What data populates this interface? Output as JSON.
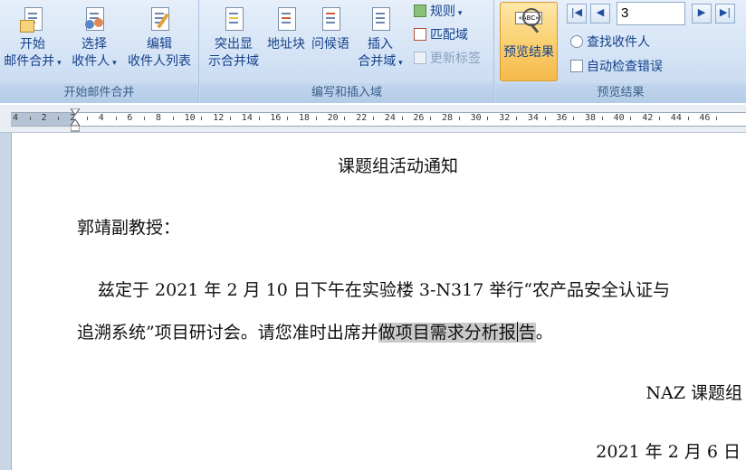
{
  "ribbon": {
    "groups": [
      {
        "label": "开始邮件合并"
      },
      {
        "label": "编写和插入域"
      },
      {
        "label": "预览结果"
      }
    ],
    "start_merge": {
      "line1": "开始",
      "line2": "邮件合并"
    },
    "select_recipients": {
      "line1": "选择",
      "line2": "收件人"
    },
    "edit_recipients": {
      "line1": "编辑",
      "line2": "收件人列表"
    },
    "highlight_fields": {
      "line1": "突出显",
      "line2": "示合并域"
    },
    "address_block": {
      "label": "地址块"
    },
    "greeting_line": {
      "label": "问候语"
    },
    "insert_field": {
      "line1": "插入",
      "line2": "合并域"
    },
    "rules": {
      "label": "规则"
    },
    "match_fields": {
      "label": "匹配域"
    },
    "update_labels": {
      "label": "更新标签"
    },
    "preview_results": {
      "label": "预览结果"
    },
    "record_value": "3",
    "find_recipient": {
      "label": "查找收件人"
    },
    "auto_check": {
      "label": "自动检查错误"
    }
  },
  "ruler": {
    "labels": [
      "4",
      "2",
      "2",
      "4",
      "6",
      "8",
      "10",
      "12",
      "14",
      "16",
      "18",
      "20",
      "22",
      "24",
      "26",
      "28",
      "30",
      "32",
      "34",
      "36",
      "38",
      "40",
      "42",
      "44",
      "46"
    ]
  },
  "document": {
    "title": "课题组活动通知",
    "salutation": "郭靖副教授：",
    "body_line1": "兹定于 2021 年 2 月 10 日下午在实验楼 3-N317 举行“农产品安全认证与",
    "body_line2_before": "追溯系统”项目研讨会。请您准时出席并",
    "body_line2_highlight_a": "做项目需求分析报",
    "body_line2_highlight_b": "告",
    "body_line2_after": "。",
    "signature": "NAZ 课题组",
    "date": "2021 年 2 月 6 日"
  }
}
